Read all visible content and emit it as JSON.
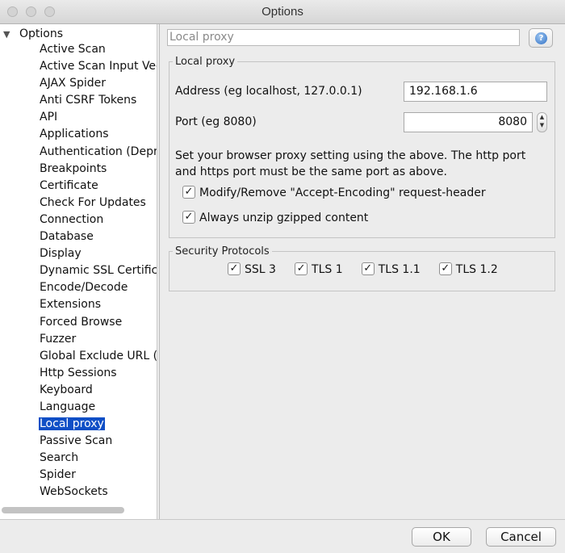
{
  "window": {
    "title": "Options"
  },
  "tree": {
    "root": "Options",
    "items": [
      {
        "label": "Active Scan"
      },
      {
        "label": "Active Scan Input Vectors"
      },
      {
        "label": "AJAX Spider"
      },
      {
        "label": "Anti CSRF Tokens"
      },
      {
        "label": "API"
      },
      {
        "label": "Applications"
      },
      {
        "label": "Authentication (Deprecated)"
      },
      {
        "label": "Breakpoints"
      },
      {
        "label": "Certificate"
      },
      {
        "label": "Check For Updates"
      },
      {
        "label": "Connection"
      },
      {
        "label": "Database"
      },
      {
        "label": "Display"
      },
      {
        "label": "Dynamic SSL Certificates"
      },
      {
        "label": "Encode/Decode"
      },
      {
        "label": "Extensions"
      },
      {
        "label": "Forced Browse"
      },
      {
        "label": "Fuzzer"
      },
      {
        "label": "Global Exclude URL (Beta)"
      },
      {
        "label": "Http Sessions"
      },
      {
        "label": "Keyboard"
      },
      {
        "label": "Language"
      },
      {
        "label": "Local proxy"
      },
      {
        "label": "Passive Scan"
      },
      {
        "label": "Search"
      },
      {
        "label": "Spider"
      },
      {
        "label": "WebSockets"
      }
    ],
    "selected": "Local proxy"
  },
  "panel": {
    "title": "Local proxy",
    "help_icon": "help-icon",
    "local_proxy": {
      "legend": "Local proxy",
      "address_label": "Address (eg localhost, 127.0.0.1)",
      "address_value": "192.168.1.6",
      "port_label": "Port (eg 8080)",
      "port_value": "8080",
      "description_line1": "Set your browser proxy setting using the above. The http port",
      "description_line2": "and https port must be the same port as above.",
      "modify_label": "Modify/Remove \"Accept-Encoding\" request-header",
      "unzip_label": "Always unzip gzipped content"
    },
    "security": {
      "legend": "Security Protocols",
      "protocols": [
        {
          "label": "SSL 3",
          "checked": true
        },
        {
          "label": "TLS 1",
          "checked": true
        },
        {
          "label": "TLS 1.1",
          "checked": true
        },
        {
          "label": "TLS 1.2",
          "checked": true
        }
      ]
    }
  },
  "buttons": {
    "ok": "OK",
    "cancel": "Cancel"
  },
  "colors": {
    "selection": "#0f4fc6"
  }
}
